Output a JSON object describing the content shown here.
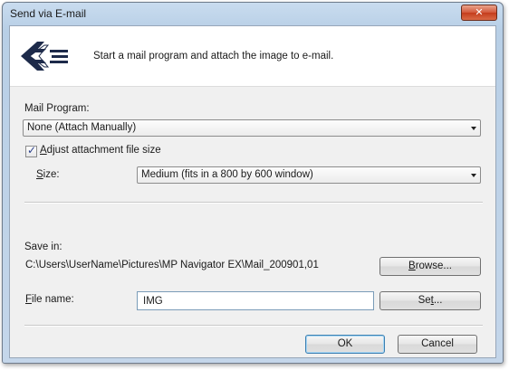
{
  "window": {
    "title": "Send via E-mail",
    "close_label": "✕"
  },
  "header": {
    "description": "Start a mail program and attach the image to e-mail."
  },
  "mail_program": {
    "label": "Mail Program:",
    "selected": "None (Attach Manually)"
  },
  "adjust_size": {
    "label_mnemonic": "A",
    "label_rest": "djust attachment file size",
    "checked": true
  },
  "size": {
    "label_mnemonic": "S",
    "label_rest": "ize:",
    "selected": "Medium (fits in a 800 by 600 window)"
  },
  "save_in": {
    "label": "Save in:",
    "path": "C:\\Users\\UserName\\Pictures\\MP Navigator EX\\Mail_200901,01",
    "browse_mnemonic": "B",
    "browse_rest": "rowse..."
  },
  "file_name": {
    "label_mnemonic": "F",
    "label_rest": "ile name:",
    "value": "IMG",
    "set_mnemonic_prefix": "Se",
    "set_mnemonic": "t",
    "set_rest": "..."
  },
  "actions": {
    "ok_label": "OK",
    "cancel_label": "Cancel"
  },
  "colors": {
    "title_gradient_top": "#c9dcef",
    "close_button": "#d2573a",
    "checkmark": "#2a3f8a"
  }
}
